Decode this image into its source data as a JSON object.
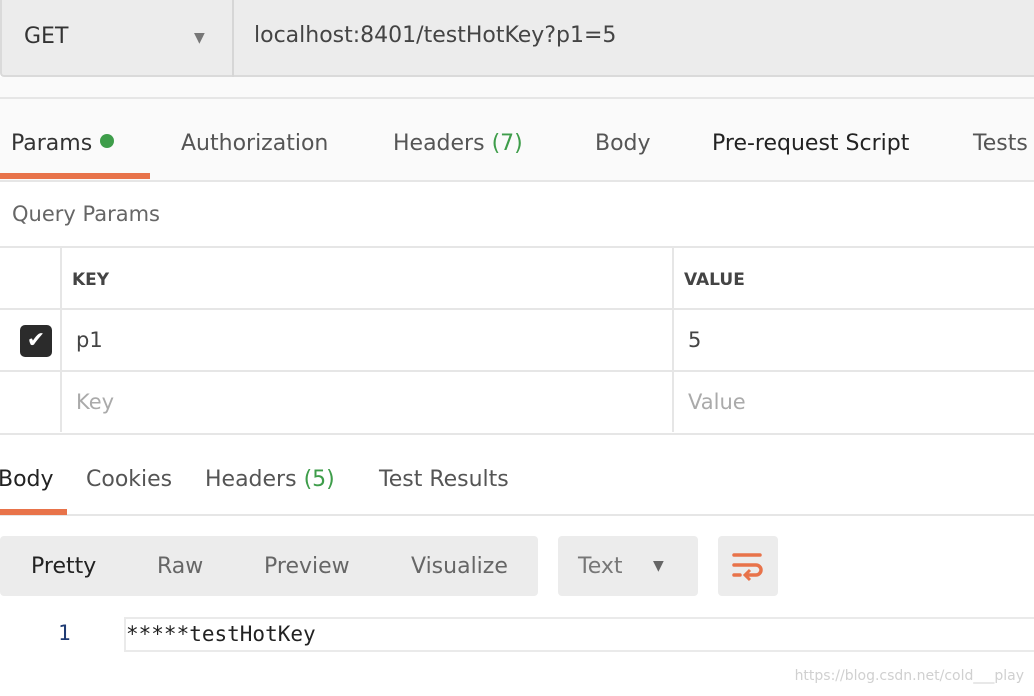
{
  "request": {
    "method": "GET",
    "url": "localhost:8401/testHotKey?p1=5"
  },
  "request_tabs": [
    {
      "label": "Params",
      "active": true,
      "indicator": "green-dot"
    },
    {
      "label": "Authorization"
    },
    {
      "label": "Headers",
      "count": "(7)"
    },
    {
      "label": "Body"
    },
    {
      "label": "Pre-request Script"
    },
    {
      "label": "Tests"
    }
  ],
  "query_params": {
    "title": "Query Params",
    "columns": [
      "KEY",
      "VALUE"
    ],
    "rows": [
      {
        "checked": true,
        "key": "p1",
        "value": "5"
      }
    ],
    "placeholder": {
      "key": "Key",
      "value": "Value"
    }
  },
  "response_tabs": [
    {
      "label": "Body",
      "active": true
    },
    {
      "label": "Cookies"
    },
    {
      "label": "Headers",
      "count": "(5)"
    },
    {
      "label": "Test Results"
    }
  ],
  "view_modes": [
    "Pretty",
    "Raw",
    "Preview",
    "Visualize"
  ],
  "active_view": "Pretty",
  "format_select": "Text",
  "wrap_icon": "wrap-lines-icon",
  "response_lines": [
    {
      "number": "1",
      "text": "*****testHotKey"
    }
  ],
  "watermark": "https://blog.csdn.net/cold___play",
  "colors": {
    "accent": "#e8734a",
    "count_green": "#3e9d4a"
  }
}
